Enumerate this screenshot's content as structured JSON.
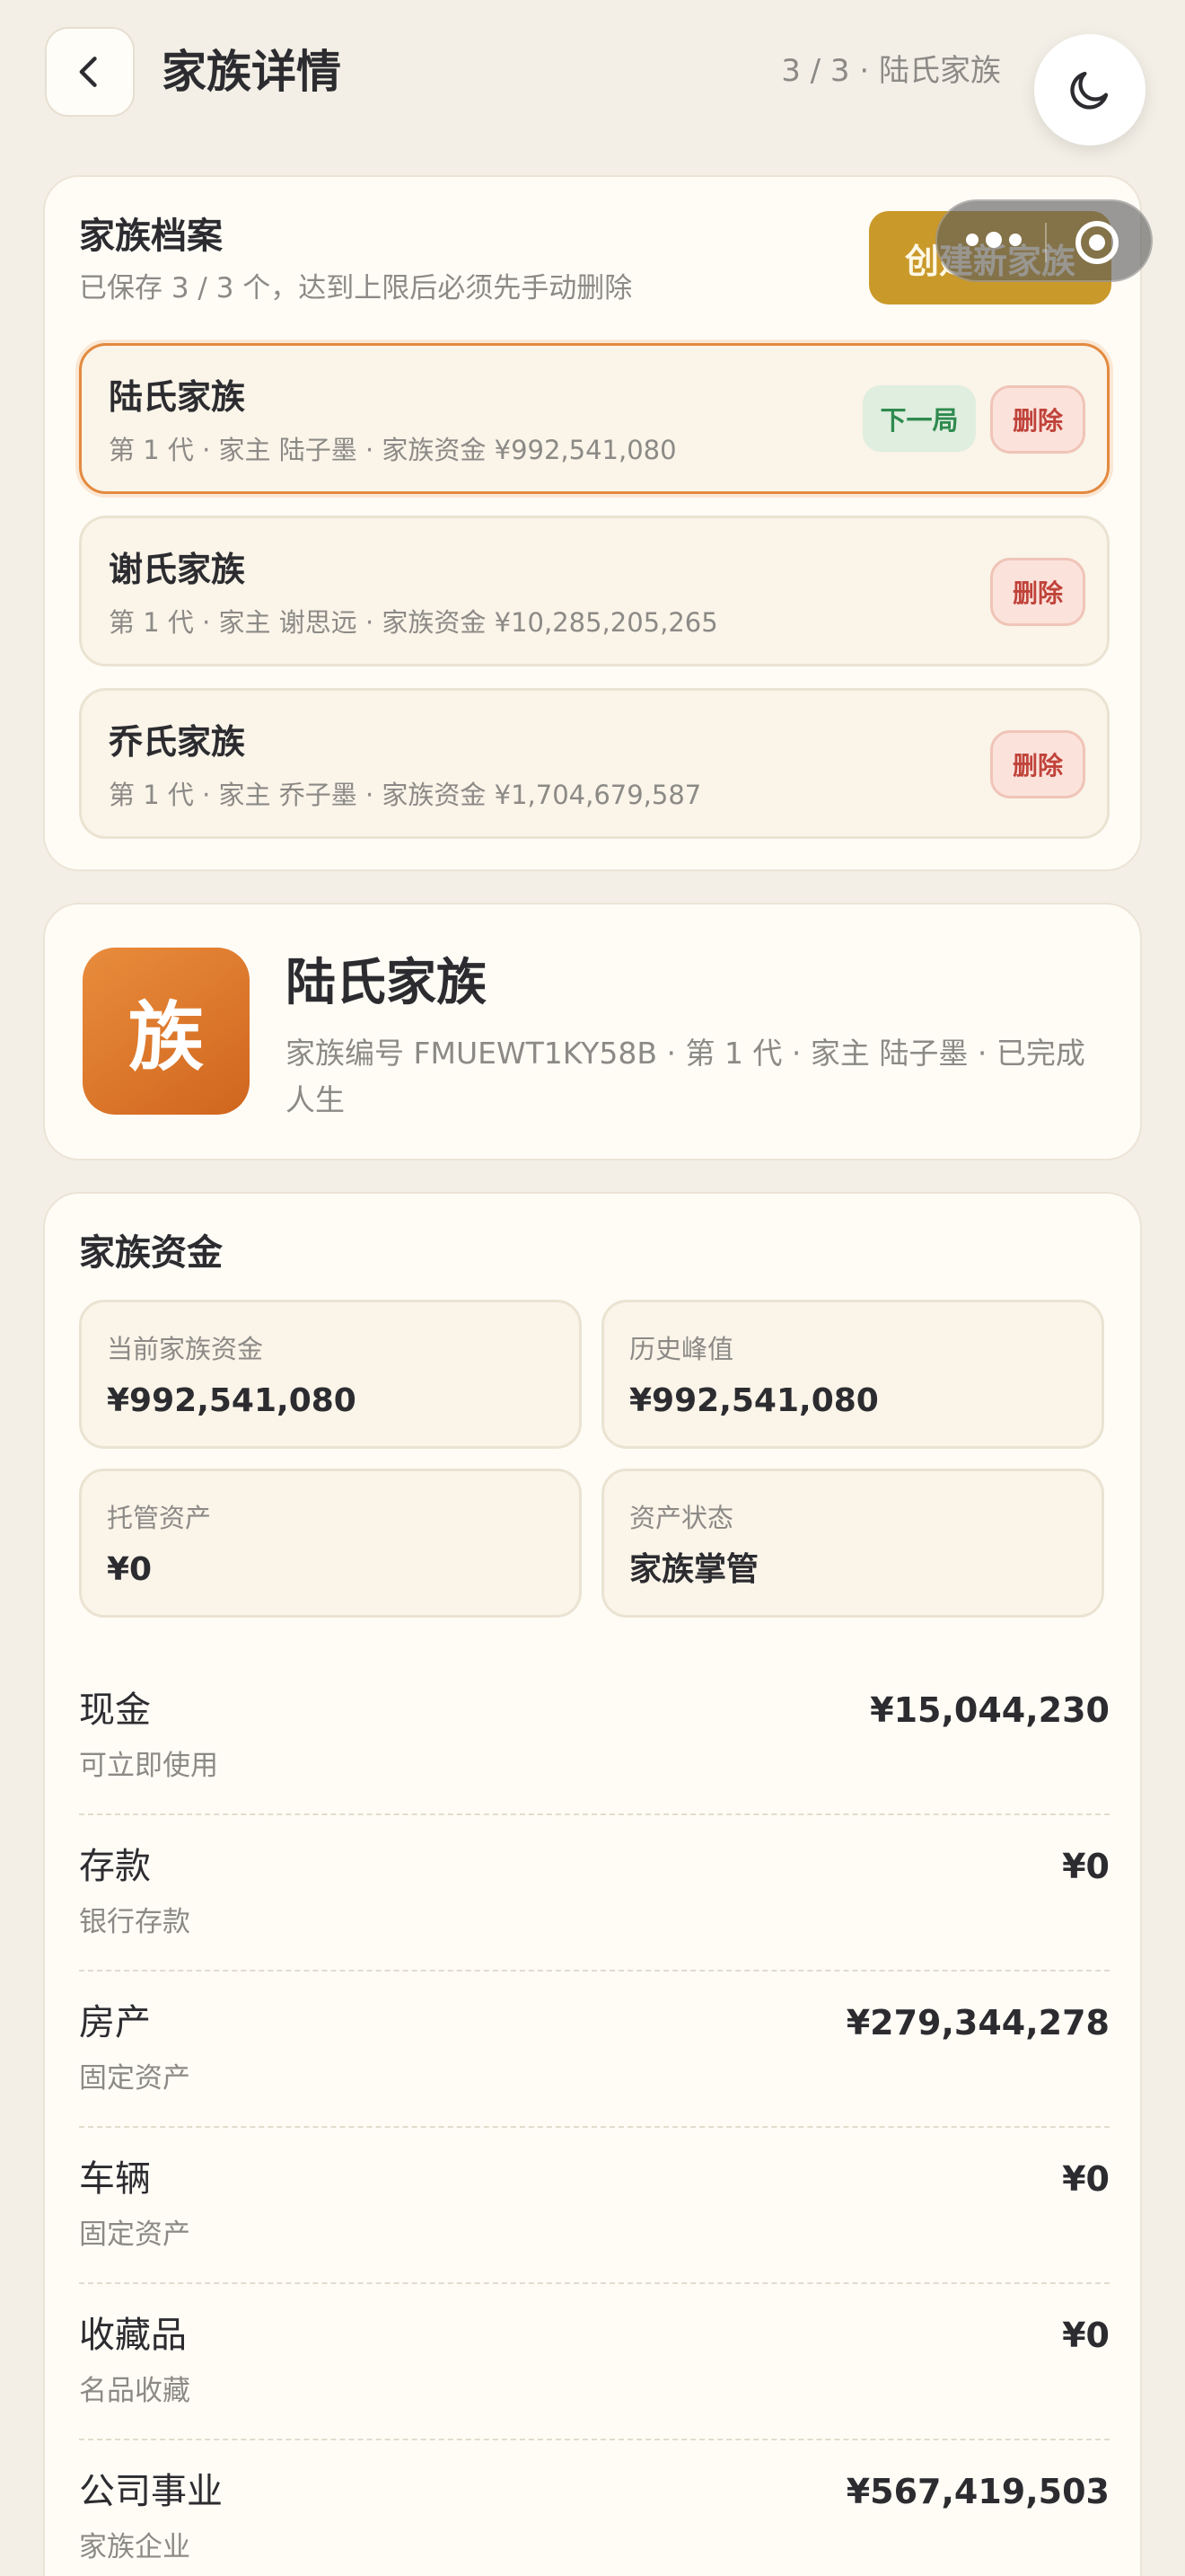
{
  "header": {
    "title": "家族详情",
    "meta": "3 / 3 · 陆氏家族"
  },
  "archive": {
    "title": "家族档案",
    "subtitle": "已保存 3 / 3 个，达到上限后必须先手动删除",
    "create_label": "创建新家族",
    "families": [
      {
        "name": "陆氏家族",
        "meta": "第 1 代 · 家主 陆子墨 · 家族资金 ¥992,541,080",
        "next_label": "下一局",
        "delete_label": "删除"
      },
      {
        "name": "谢氏家族",
        "meta": "第 1 代 · 家主 谢思远 · 家族资金 ¥10,285,205,265",
        "delete_label": "删除"
      },
      {
        "name": "乔氏家族",
        "meta": "第 1 代 · 家主 乔子墨 · 家族资金 ¥1,704,679,587",
        "delete_label": "删除"
      }
    ]
  },
  "profile": {
    "avatar_char": "族",
    "name": "陆氏家族",
    "meta": "家族编号 FMUEWT1KY58B · 第 1 代 · 家主 陆子墨 · 已完成人生"
  },
  "funds": {
    "title": "家族资金",
    "stats": [
      {
        "label": "当前家族资金",
        "value": "¥992,541,080"
      },
      {
        "label": "历史峰值",
        "value": "¥992,541,080"
      },
      {
        "label": "托管资产",
        "value": "¥0"
      },
      {
        "label": "资产状态",
        "value": "家族掌管"
      }
    ],
    "assets": [
      {
        "name": "现金",
        "desc": "可立即使用",
        "value": "¥15,044,230"
      },
      {
        "name": "存款",
        "desc": "银行存款",
        "value": "¥0"
      },
      {
        "name": "房产",
        "desc": "固定资产",
        "value": "¥279,344,278"
      },
      {
        "name": "车辆",
        "desc": "固定资产",
        "value": "¥0"
      },
      {
        "name": "收藏品",
        "desc": "名品收藏",
        "value": "¥0"
      },
      {
        "name": "公司事业",
        "desc": "家族企业",
        "value": "¥567,419,503"
      }
    ]
  },
  "colors": {
    "background": "#f3efe6",
    "accent_gold": "#c9992a",
    "accent_orange": "#e38a3f",
    "danger": "#c0433a",
    "success": "#2f8a4f"
  },
  "icons": {
    "back": "chevron-left-icon",
    "theme": "moon-icon",
    "capsule_more": "more-dots-icon",
    "capsule_close": "record-icon"
  }
}
